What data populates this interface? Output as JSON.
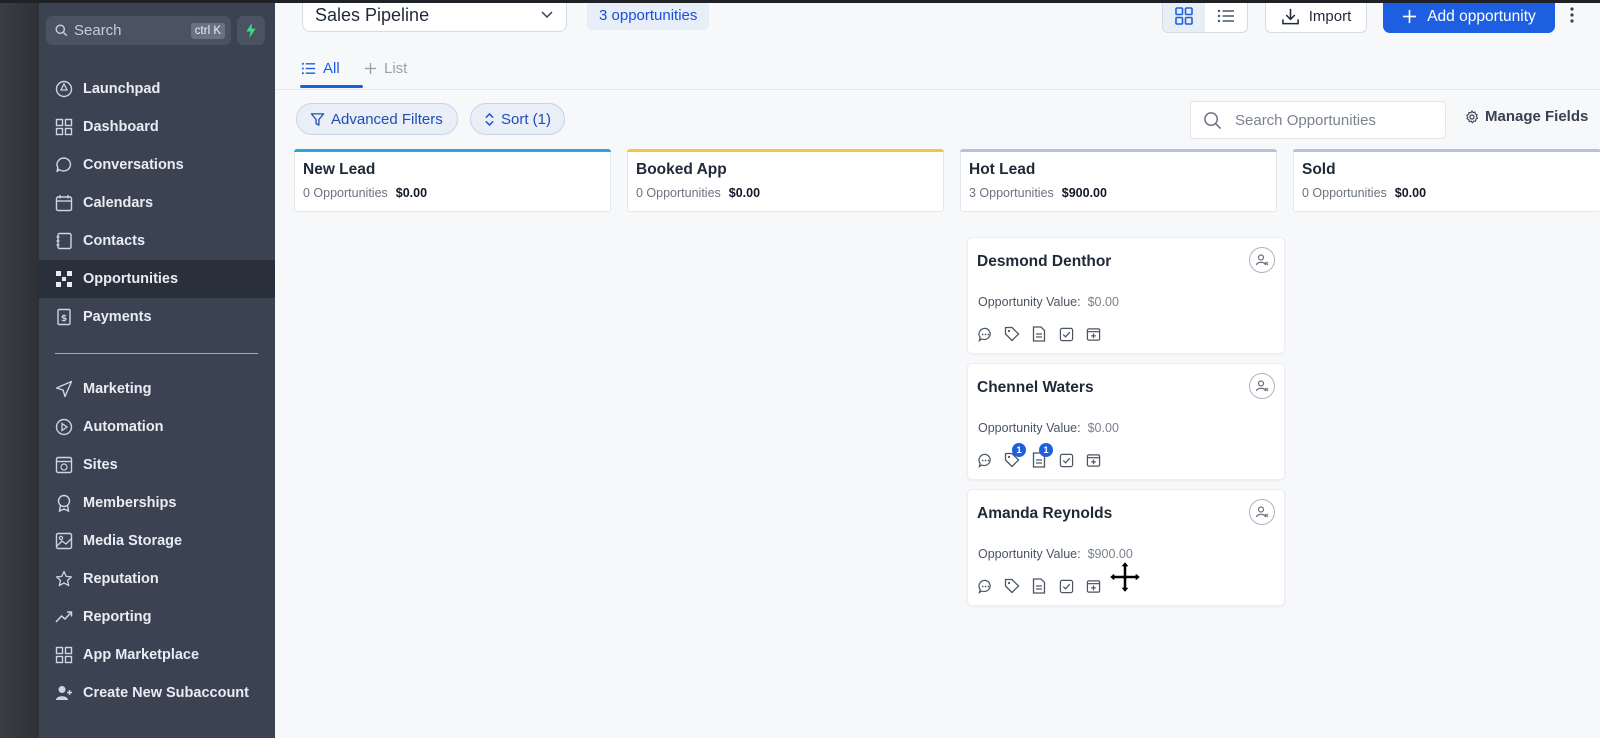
{
  "sidebar": {
    "search": {
      "placeholder": "Search",
      "shortcut": "ctrl K"
    },
    "items": [
      {
        "label": "Launchpad",
        "icon": "rocket-icon"
      },
      {
        "label": "Dashboard",
        "icon": "grid-icon"
      },
      {
        "label": "Conversations",
        "icon": "chat-icon"
      },
      {
        "label": "Calendars",
        "icon": "calendar-icon"
      },
      {
        "label": "Contacts",
        "icon": "contacts-icon"
      },
      {
        "label": "Opportunities",
        "icon": "opportunities-icon",
        "active": true
      },
      {
        "label": "Payments",
        "icon": "receipt-icon"
      }
    ],
    "items2": [
      {
        "label": "Marketing",
        "icon": "send-icon"
      },
      {
        "label": "Automation",
        "icon": "automation-icon"
      },
      {
        "label": "Sites",
        "icon": "sites-icon"
      },
      {
        "label": "Memberships",
        "icon": "award-icon"
      },
      {
        "label": "Media Storage",
        "icon": "image-icon"
      },
      {
        "label": "Reputation",
        "icon": "star-icon"
      },
      {
        "label": "Reporting",
        "icon": "trending-icon"
      },
      {
        "label": "App Marketplace",
        "icon": "grid-icon"
      },
      {
        "label": "Create New Subaccount",
        "icon": "add-user-icon"
      }
    ]
  },
  "header": {
    "pipeline": "Sales Pipeline",
    "opp_count": "3 opportunities",
    "import_label": "Import",
    "add_label": "Add opportunity"
  },
  "tabs": {
    "all": "All",
    "list": "List"
  },
  "filters": {
    "advanced": "Advanced Filters",
    "sort": "Sort (1)",
    "search_placeholder": "Search Opportunities",
    "manage_fields": "Manage Fields"
  },
  "stages": [
    {
      "name": "New Lead",
      "count": "0 Opportunities",
      "value": "$0.00",
      "color": "#27a7e0"
    },
    {
      "name": "Booked App",
      "count": "0 Opportunities",
      "value": "$0.00",
      "color": "#f5c542"
    },
    {
      "name": "Hot Lead",
      "count": "3 Opportunities",
      "value": "$900.00",
      "color": "#b9bfe2"
    },
    {
      "name": "Sold",
      "count": "0 Opportunities",
      "value": "$0.00",
      "color": "#b9bfe2"
    }
  ],
  "cards": [
    {
      "name": "Desmond Denthor",
      "value_label": "Opportunity Value:",
      "value": "$0.00",
      "badges": [
        "",
        "",
        "",
        "",
        ""
      ]
    },
    {
      "name": "Chennel Waters",
      "value_label": "Opportunity Value:",
      "value": "$0.00",
      "badges": [
        "",
        "1",
        "1",
        "",
        ""
      ]
    },
    {
      "name": "Amanda Reynolds",
      "value_label": "Opportunity Value:",
      "value": "$900.00",
      "badges": [
        "",
        "",
        "",
        "",
        ""
      ]
    }
  ],
  "colors": {
    "accent": "#1d5fe0",
    "sidebar": "#3b4252"
  }
}
